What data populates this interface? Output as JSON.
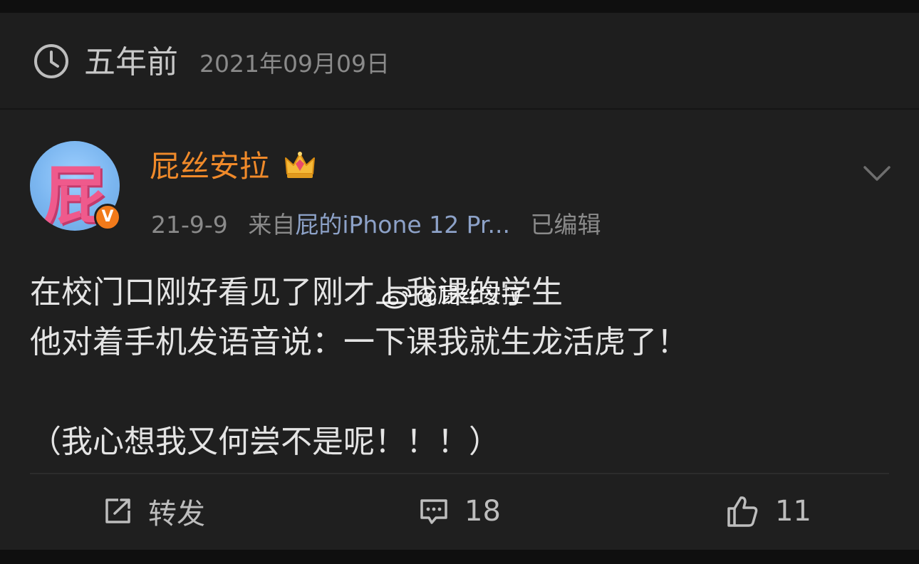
{
  "memory": {
    "ago": "五年前",
    "date": "2021年09月09日"
  },
  "post": {
    "username": "屁丝安拉",
    "avatar_char": "屁",
    "verified_mark": "V",
    "date": "21-9-9",
    "from_label": "来自",
    "device": "屁的iPhone 12 Pr...",
    "edited": "已编辑",
    "lines": [
      "在校门口刚好看见了刚才上我课的学生",
      "他对着手机发语音说：一下课我就生龙活虎了！",
      "",
      "（我心想我又何尝不是呢！！！）"
    ],
    "watermark": "@屁丝安拉"
  },
  "actions": {
    "repost_label": "转发",
    "comment_count": "18",
    "like_count": "11"
  },
  "colors": {
    "username": "#f08a2a",
    "device": "#8da2c8",
    "badge": "#f27a1a",
    "background": "#1f1f1f"
  },
  "icons": [
    "clock-icon",
    "crown-icon",
    "chevron-down-icon",
    "repost-icon",
    "comment-icon",
    "like-icon",
    "weibo-logo-icon"
  ]
}
